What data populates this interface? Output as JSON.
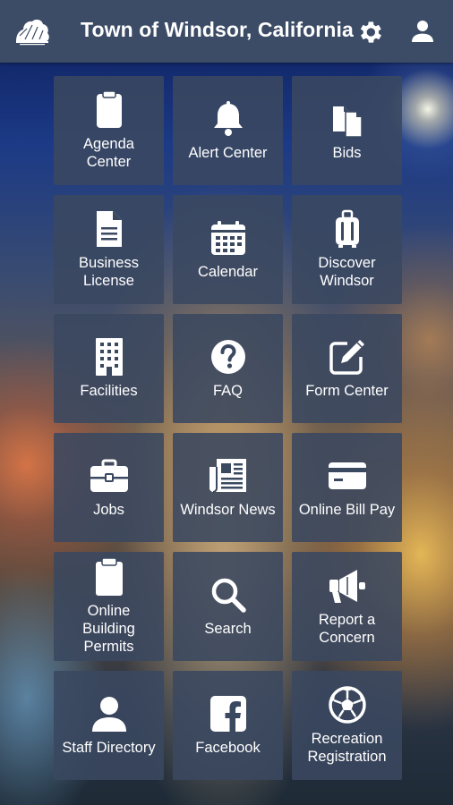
{
  "header": {
    "title": "Town of Windsor, California",
    "logo_icon": "town-logo-icon",
    "settings_icon": "gear-icon",
    "account_icon": "user-icon"
  },
  "colors": {
    "header_bg": "#3c4c66",
    "tile_bg": "#3a4860",
    "text": "#ffffff"
  },
  "tiles": [
    {
      "label": "Agenda\nCenter",
      "icon": "clipboard-icon"
    },
    {
      "label": "Alert Center",
      "icon": "bell-icon"
    },
    {
      "label": "Bids",
      "icon": "documents-icon"
    },
    {
      "label": "Business\nLicense",
      "icon": "document-icon"
    },
    {
      "label": "Calendar",
      "icon": "calendar-icon"
    },
    {
      "label": "Discover\nWindsor",
      "icon": "luggage-icon"
    },
    {
      "label": "Facilities",
      "icon": "building-icon"
    },
    {
      "label": "FAQ",
      "icon": "question-icon"
    },
    {
      "label": "Form Center",
      "icon": "edit-icon"
    },
    {
      "label": "Jobs",
      "icon": "briefcase-icon"
    },
    {
      "label": "Windsor News",
      "icon": "newspaper-icon"
    },
    {
      "label": "Online Bill Pay",
      "icon": "credit-card-icon"
    },
    {
      "label": "Online\nBuilding\nPermits",
      "icon": "clipboard-icon"
    },
    {
      "label": "Search",
      "icon": "search-icon"
    },
    {
      "label": "Report a\nConcern",
      "icon": "megaphone-icon"
    },
    {
      "label": "Staff Directory",
      "icon": "person-icon"
    },
    {
      "label": "Facebook",
      "icon": "facebook-icon"
    },
    {
      "label": "Recreation\nRegistration",
      "icon": "soccer-ball-icon"
    }
  ]
}
